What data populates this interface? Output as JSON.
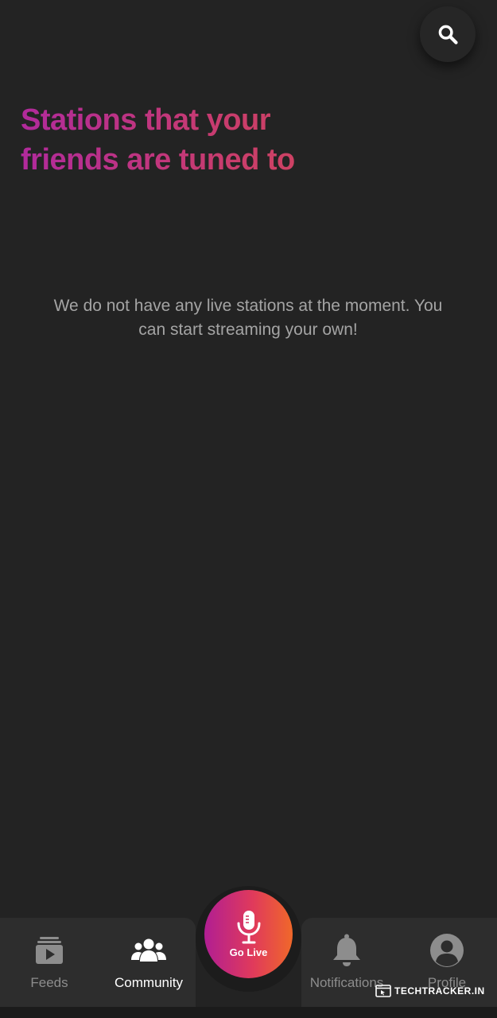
{
  "header": {
    "title": "Stations that your friends are tuned to",
    "search_icon": "search-icon"
  },
  "main": {
    "empty_message": "We do not have any live stations at the moment. You can start streaming your own!"
  },
  "bottom_nav": {
    "items": [
      {
        "label": "Feeds",
        "icon": "feeds-icon",
        "active": false
      },
      {
        "label": "Community",
        "icon": "community-icon",
        "active": true
      },
      {
        "label": "Notifications",
        "icon": "bell-icon",
        "active": false
      },
      {
        "label": "Profile",
        "icon": "profile-icon",
        "active": false
      }
    ],
    "go_live": {
      "label": "Go Live",
      "icon": "microphone-icon"
    }
  },
  "watermark": {
    "text": "TECHTRACKER.IN"
  },
  "colors": {
    "background": "#232323",
    "nav_background": "#2d2d2d",
    "heading_gradient": [
      "#b12a9c",
      "#d1465a"
    ],
    "go_live_gradient": [
      "#b11e93",
      "#f0682a"
    ],
    "active_label": "#ffffff",
    "inactive": "#8d8d8d"
  }
}
